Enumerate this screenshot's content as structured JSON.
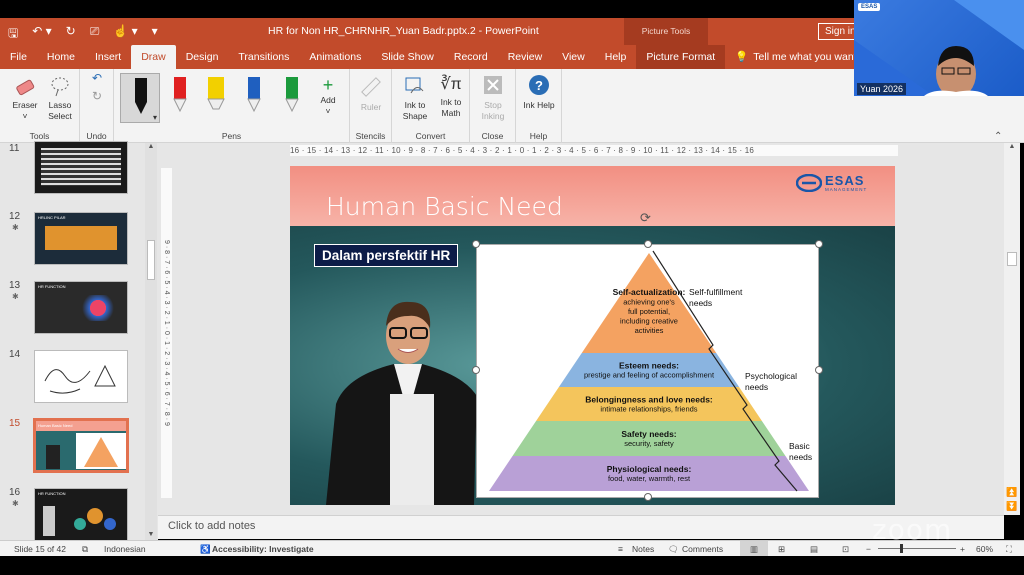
{
  "window": {
    "title": "HR for Non HR_CHRNHR_Yuan Badr.pptx.2  -  PowerPoint",
    "context_label": "Picture Tools",
    "sign_in": "Sign in"
  },
  "tabs": [
    "File",
    "Home",
    "Insert",
    "Draw",
    "Design",
    "Transitions",
    "Animations",
    "Slide Show",
    "Record",
    "Review",
    "View",
    "Help",
    "Picture Format"
  ],
  "tell_me": "Tell me what you want to do",
  "ribbon": {
    "tools": {
      "eraser": "Eraser",
      "lasso": "Lasso Select",
      "label": "Tools"
    },
    "undo_label": "Undo",
    "pens_label": "Pens",
    "add": "Add",
    "pen_colors": [
      "#111111",
      "#e02020",
      "#f2d000",
      "#1f5fbf",
      "#1b9a3c"
    ],
    "ruler": "Ruler",
    "stencils_label": "Stencils",
    "ink_to_shape": "Ink to Shape",
    "ink_to_math": "Ink to Math",
    "convert_label": "Convert",
    "stop_inking": "Stop Inking",
    "close_label": "Close",
    "ink_help": "Ink Help",
    "help_label": "Help"
  },
  "thumbnails": [
    {
      "num": "11",
      "star": false
    },
    {
      "num": "12",
      "star": true,
      "title": "HRLINC PILAR"
    },
    {
      "num": "13",
      "star": true,
      "title": "HR FUNCTION"
    },
    {
      "num": "14",
      "star": false
    },
    {
      "num": "15",
      "star": false,
      "title": "Human Basic Need",
      "selected": true
    },
    {
      "num": "16",
      "star": true,
      "title": "HR FUNCTION"
    }
  ],
  "ruler_h": "16 · 15 · 14 · 13 · 12 · 11 · 10 · 9 · 8 · 7 · 6 · 5 · 4 · 3 · 2 · 1 · 0 · 1 · 2 · 3 · 4 · 5 · 6 · 7 · 8 · 9 · 10 · 11 · 12 · 13 · 14 · 15 · 16",
  "ruler_v": "9 · 8 · 7 · 6 · 5 · 4 · 3 · 2 · 1 · 0 · 1 · 2 · 3 · 4 · 5 · 6 · 7 · 8 · 9",
  "slide": {
    "title": "Human Basic Need",
    "subtitle": "Dalam persfektif HR",
    "logo": "ESAS",
    "logo_sub": "MANAGEMENT",
    "pyramid": [
      {
        "title": "Self-actualization:",
        "lines": [
          "achieving one's",
          "full potential,",
          "including creative",
          "activities"
        ],
        "color": "#f4a261"
      },
      {
        "title": "Esteem needs:",
        "lines": [
          "prestige and feeling of accomplishment"
        ],
        "color": "#8ab4e0"
      },
      {
        "title": "Belongingness and love needs:",
        "lines": [
          "intimate relationships, friends"
        ],
        "color": "#f4c55c"
      },
      {
        "title": "Safety needs:",
        "lines": [
          "security, safety"
        ],
        "color": "#9fd29a"
      },
      {
        "title": "Physiological needs:",
        "lines": [
          "food, water, warmth, rest"
        ],
        "color": "#b9a0d6"
      }
    ],
    "brackets": [
      "Self-fulfillment needs",
      "Psychological needs",
      "Basic needs"
    ]
  },
  "notes_placeholder": "Click to add notes",
  "status": {
    "slide": "Slide 15 of 42",
    "language": "Indonesian",
    "accessibility": "Accessibility: Investigate",
    "notes": "Notes",
    "comments": "Comments",
    "zoom": "60%"
  },
  "webcam": {
    "name": "Yuan 2026",
    "logo": "ESAS"
  },
  "watermark": "zoom"
}
